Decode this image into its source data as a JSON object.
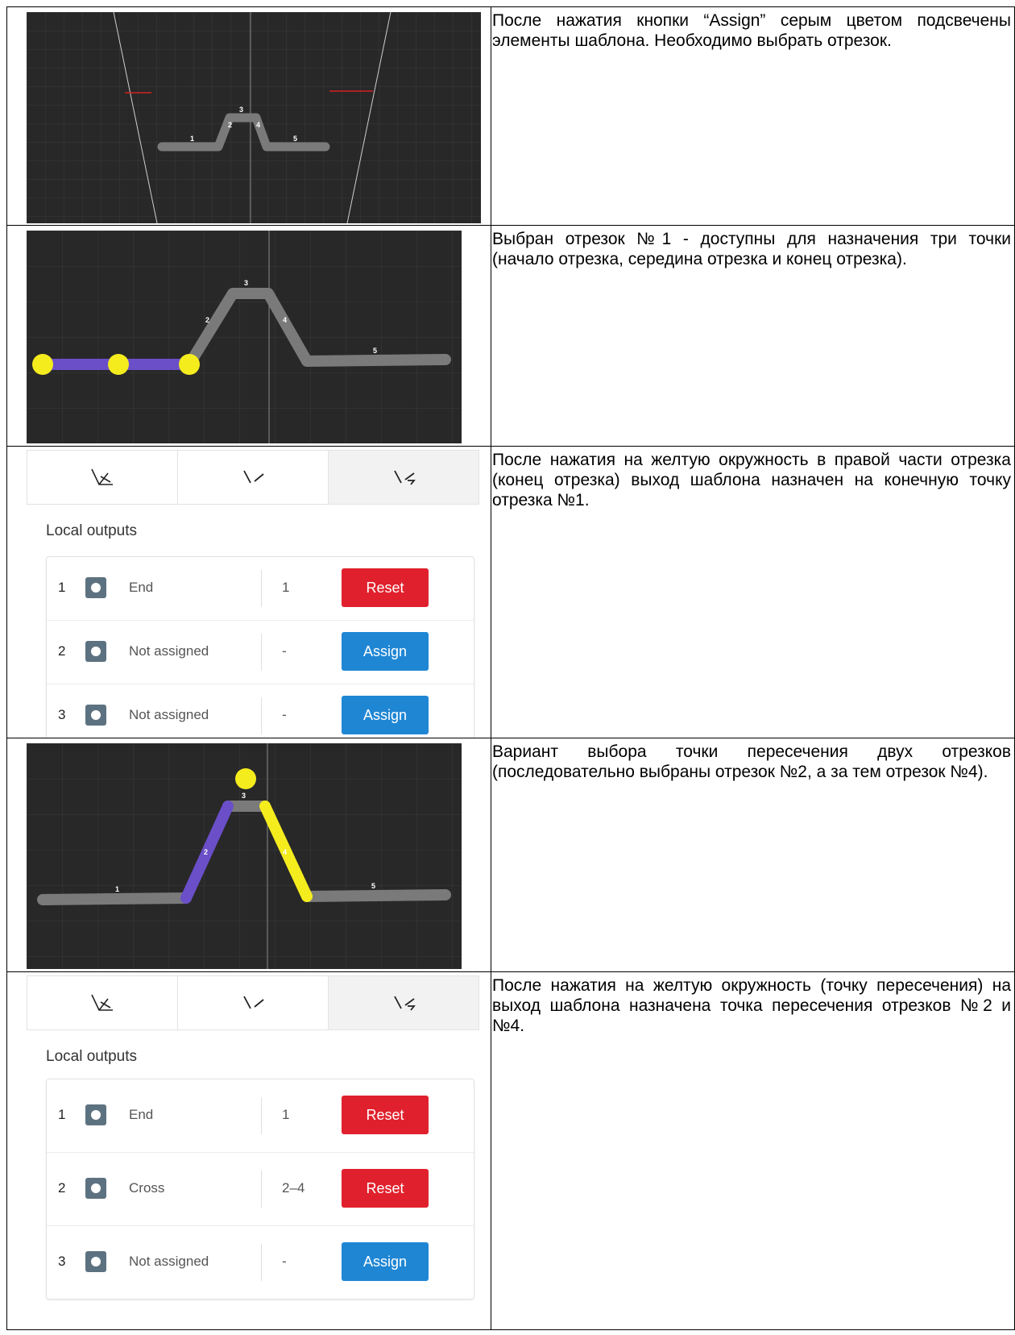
{
  "rows": [
    {
      "text": "После нажатия кнопки “Assign” серым цветом подсвечены элементы шаблона. Необходимо выбрать отрезок."
    },
    {
      "text": "Выбран отрезок №1 - доступны для назначения три точки (начало отрезка, середина отрезка и конец отрезка)."
    },
    {
      "text": "После нажатия на желтую окружность в правой части отрезка (конец отрезка) выход шаблона назначен на конечную точку отрезка №1."
    },
    {
      "text": "Вариант выбора точки пересечения двух отрезков (последовательно выбраны отрезок №2, а за тем отрезок №4)."
    },
    {
      "text": "После нажатия на желтую окружность (точку пересечения) на выход шаблона назначена точка пересечения отрезков №2 и №4."
    }
  ],
  "segment_labels": [
    "1",
    "2",
    "3",
    "4",
    "5"
  ],
  "panel1": {
    "title": "Local outputs",
    "outputs": [
      {
        "num": "1",
        "label": "End",
        "value": "1",
        "button": "Reset"
      },
      {
        "num": "2",
        "label": "Not assigned",
        "value": "-",
        "button": "Assign"
      },
      {
        "num": "3",
        "label": "Not assigned",
        "value": "-",
        "button": "Assign"
      }
    ]
  },
  "panel2": {
    "title": "Local outputs",
    "outputs": [
      {
        "num": "1",
        "label": "End",
        "value": "1",
        "button": "Reset"
      },
      {
        "num": "2",
        "label": "Cross",
        "value": "2–4",
        "button": "Reset"
      },
      {
        "num": "3",
        "label": "Not assigned",
        "value": "-",
        "button": "Assign"
      }
    ]
  },
  "colors": {
    "canvas": "#282828",
    "segment": "#7a7a7a",
    "selected": "#6a4fc8",
    "point": "#f5ec1e",
    "reset": "#e0212d",
    "assign": "#1f86d4"
  }
}
